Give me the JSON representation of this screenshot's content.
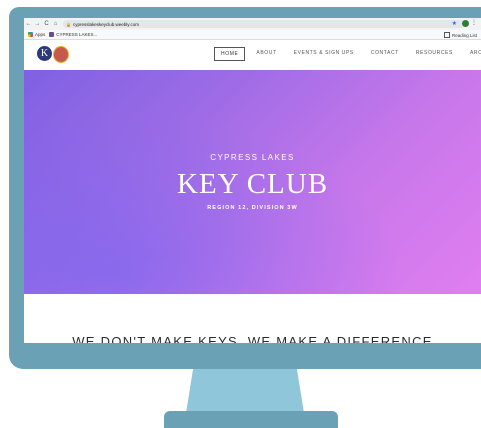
{
  "browser": {
    "nav": {
      "back": "←",
      "forward": "→",
      "reload": "C",
      "home": "⌂"
    },
    "url": "cypresslakeskeyclub.weebly.com",
    "bookmarks": [
      {
        "label": "Apps"
      },
      {
        "label": "CYPRESS LAKES..."
      }
    ],
    "reading_list": "Reading List"
  },
  "site": {
    "logo_letter": "K",
    "nav": [
      "HOME",
      "ABOUT",
      "EVENTS & SIGN UPS",
      "CONTACT",
      "RESOURCES",
      "ARCHIVE"
    ],
    "active_nav": "HOME"
  },
  "hero": {
    "subtitle": "CYPRESS LAKES",
    "title": "KEY CLUB",
    "region": "REGION 12, DIVISION 3W"
  },
  "tagline": "WE DON'T MAKE KEYS, WE MAKE A DIFFERENCE",
  "colors": {
    "bezel": "#6aa1b5",
    "stand": "#8fc6d9",
    "hero_start": "#7f61e3",
    "hero_end": "#e07ef0"
  }
}
